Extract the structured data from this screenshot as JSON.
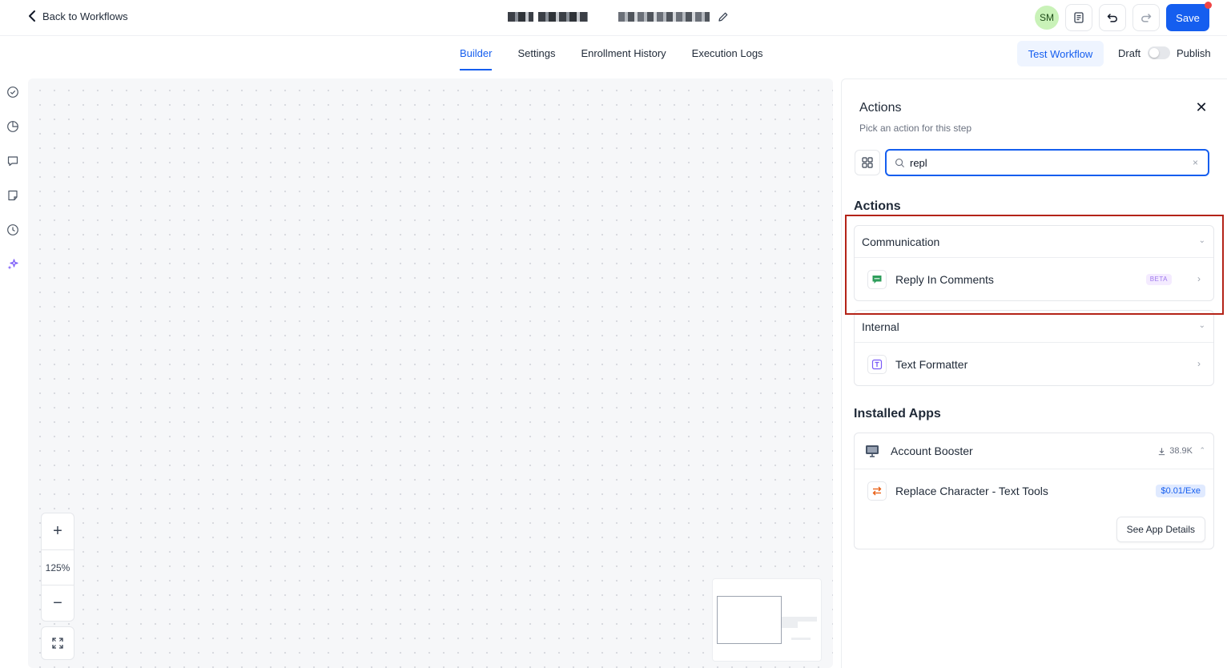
{
  "topbar": {
    "back_label": "Back to Workflows",
    "avatar_initials": "SM",
    "save_label": "Save"
  },
  "tabs": [
    {
      "label": "Builder",
      "active": true
    },
    {
      "label": "Settings",
      "active": false
    },
    {
      "label": "Enrollment History",
      "active": false
    },
    {
      "label": "Execution Logs",
      "active": false
    }
  ],
  "toolbar": {
    "test_label": "Test Workflow",
    "draft_label": "Draft",
    "publish_label": "Publish"
  },
  "canvas": {
    "zoom_in": "+",
    "zoom_level": "125%",
    "zoom_out": "−"
  },
  "panel": {
    "title": "Actions",
    "subtitle": "Pick an action for this step",
    "close": "✕",
    "search": {
      "value": "repl",
      "clear": "×"
    },
    "actions_heading": "Actions",
    "groups": [
      {
        "name": "Communication",
        "items": [
          {
            "label": "Reply In Comments",
            "badge": "BETA"
          }
        ]
      },
      {
        "name": "Internal",
        "items": [
          {
            "label": "Text Formatter"
          }
        ]
      }
    ],
    "installed_heading": "Installed Apps",
    "app": {
      "name": "Account Booster",
      "downloads": "38.9K",
      "action": {
        "label": "Replace Character - Text Tools",
        "price": "$0.01/Exe"
      },
      "details_button": "See App Details"
    }
  },
  "colors": {
    "primary": "#155eef",
    "highlight": "#b42318",
    "canvas_bg": "#f6f7f9"
  }
}
